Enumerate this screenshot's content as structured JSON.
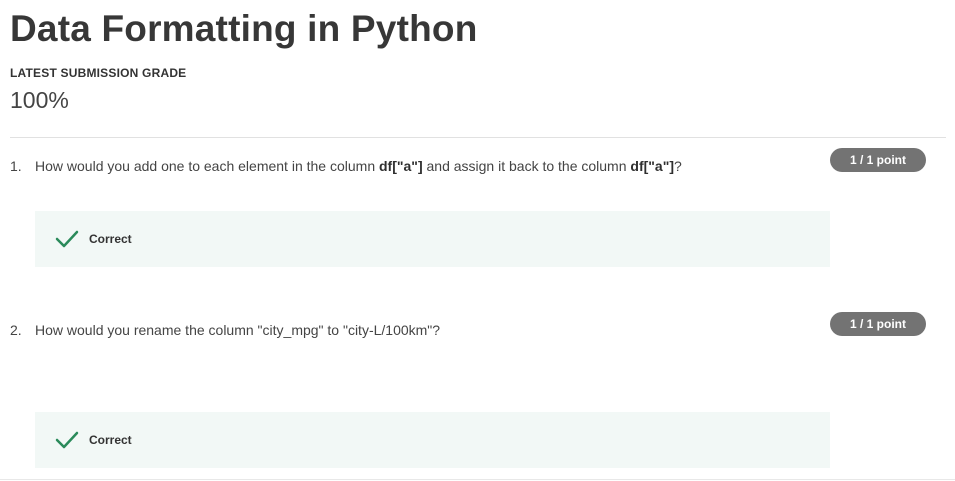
{
  "page": {
    "title": "Data Formatting in Python",
    "grade_label": "LATEST SUBMISSION GRADE",
    "grade_value": "100%"
  },
  "questions": [
    {
      "number": "1.",
      "text_parts": [
        "How would you add one to each element in the column ",
        "df[\"a\"]",
        " and assign it back to the column ",
        "df[\"a\"]",
        "?"
      ],
      "points": "1 / 1 point",
      "feedback": "Correct",
      "feedback_icon": "checkmark-icon"
    },
    {
      "number": "2.",
      "text": "How would you rename the column \"city_mpg\" to \"city-L/100km\"?",
      "points": "1 / 1 point",
      "feedback": "Correct",
      "feedback_icon": "checkmark-icon"
    }
  ],
  "colors": {
    "correct_green": "#2a8a5a",
    "feedback_bg": "#f2f8f6",
    "badge_bg": "#737373"
  }
}
